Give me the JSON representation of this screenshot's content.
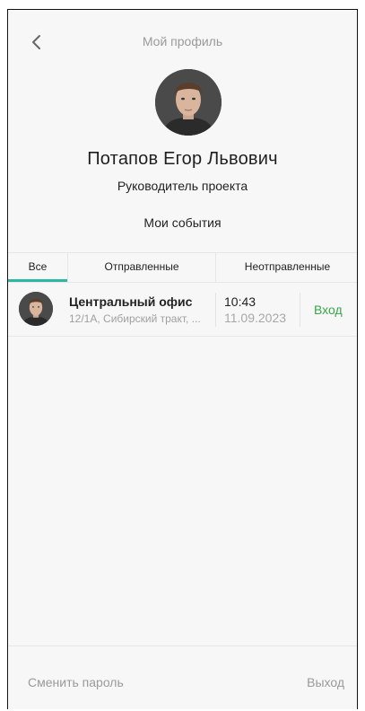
{
  "header": {
    "title": "Мой профиль",
    "back_icon": "chevron-left-icon"
  },
  "profile": {
    "name": "Потапов Егор  Львович",
    "role": "Руководитель проекта",
    "avatar": "portrait-avatar"
  },
  "events": {
    "title": "Мои события",
    "tabs": [
      {
        "label": "Все",
        "active": true
      },
      {
        "label": "Отправленные",
        "active": false
      },
      {
        "label": "Неотправленные",
        "active": false
      }
    ],
    "items": [
      {
        "place": "Центральный офис",
        "address": "12/1А, Сибирский тракт, ...",
        "time": "10:43",
        "date": "11.09.2023",
        "status": "Вход"
      }
    ]
  },
  "footer": {
    "change_password": "Сменить пароль",
    "logout": "Выход"
  },
  "colors": {
    "accent": "#2bb9a4",
    "status_green": "#37a84a",
    "muted": "#9a9a9a",
    "background": "#f7f7f7"
  }
}
